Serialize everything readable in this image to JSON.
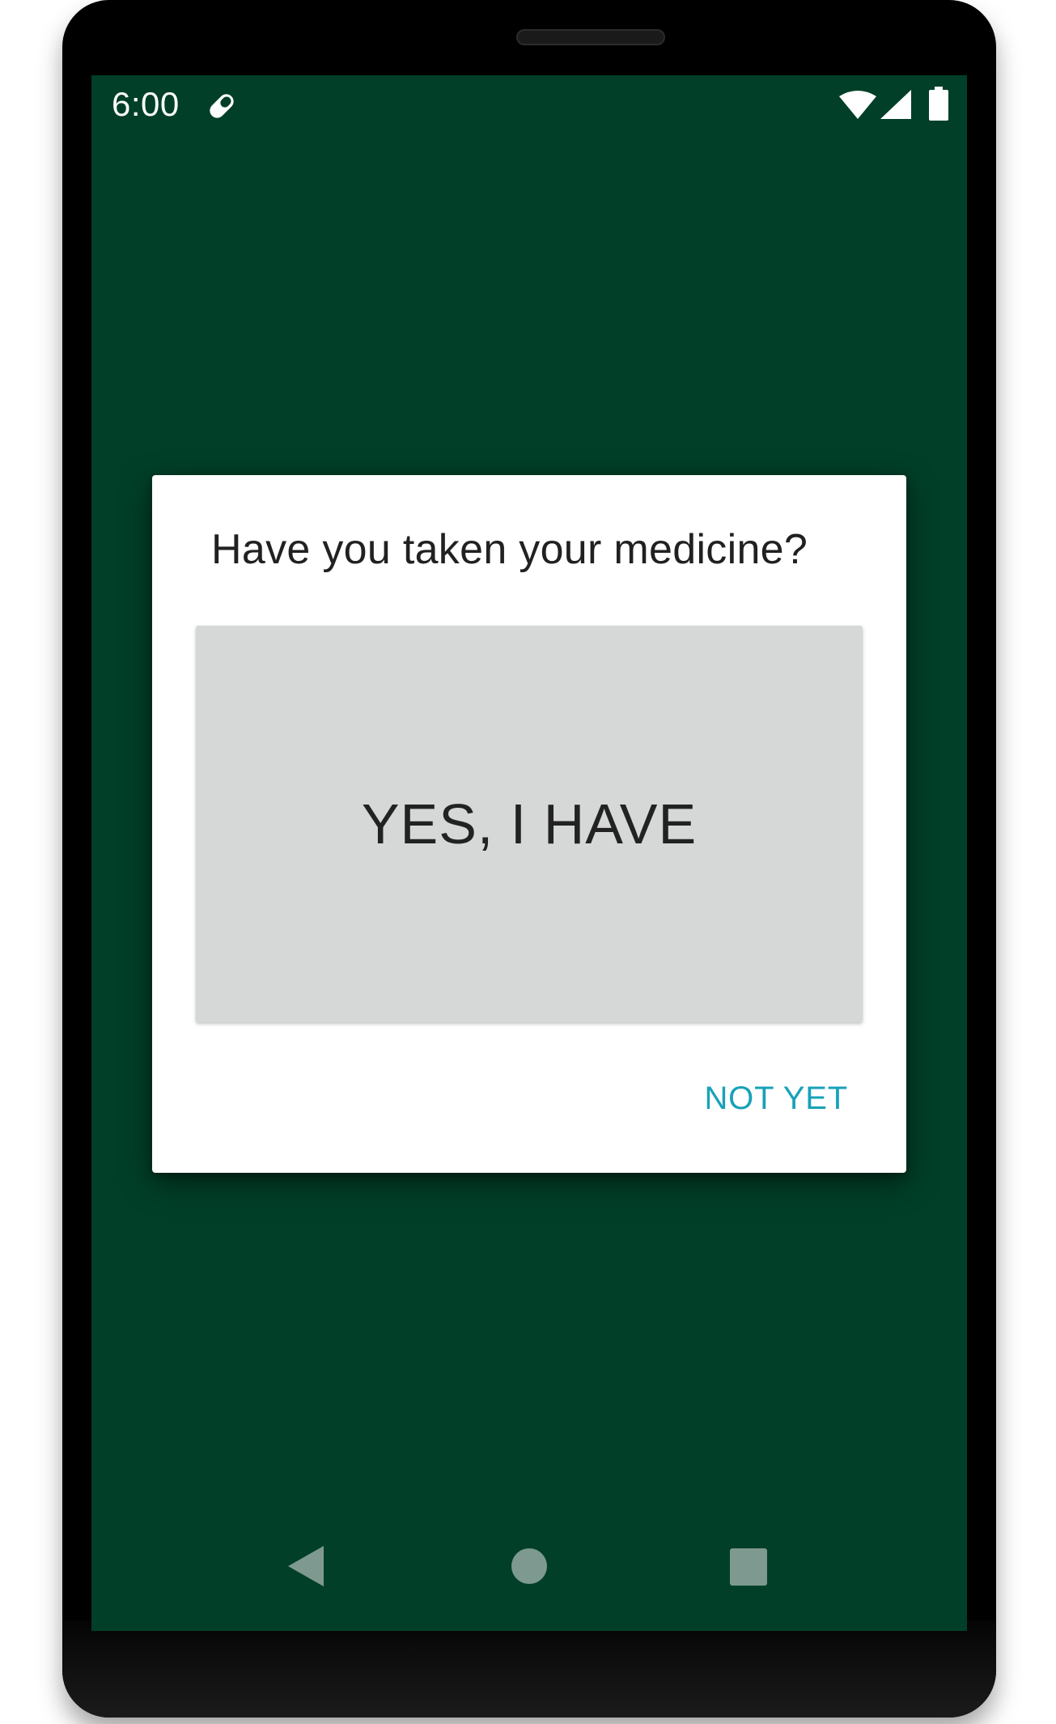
{
  "status_bar": {
    "time": "6:00",
    "notification_icon": "pill-icon",
    "icons": [
      "wifi-icon",
      "signal-icon",
      "battery-icon"
    ]
  },
  "dialog": {
    "title": "Have you taken your medicine?",
    "primary_button_label": "YES, I HAVE",
    "secondary_button_label": "NOT YET"
  },
  "nav_bar": {
    "icons": [
      "back-icon",
      "home-icon",
      "recents-icon"
    ]
  },
  "colors": {
    "screen_background": "#013f28",
    "dialog_background": "#ffffff",
    "primary_button_background": "#d6d7d7",
    "accent": "#17a2b8",
    "nav_icon": "#7e9a90"
  }
}
